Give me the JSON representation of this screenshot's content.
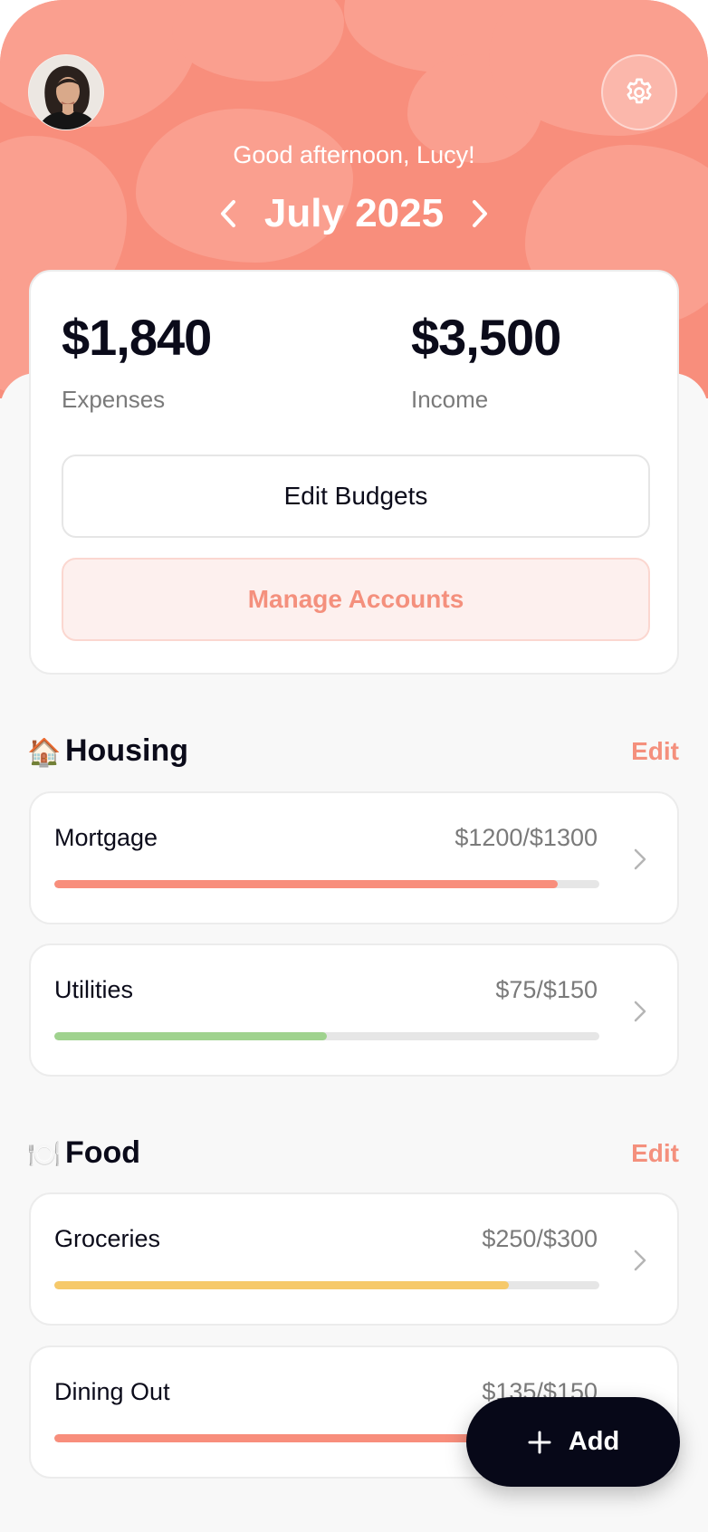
{
  "header": {
    "greeting": "Good afternoon, Lucy!",
    "month": "July 2025",
    "avatar_icon": "user-avatar",
    "settings_icon": "gear-icon",
    "prev_icon": "chevron-left-icon",
    "next_icon": "chevron-right-icon"
  },
  "summary": {
    "expenses_value": "$1,840",
    "expenses_label": "Expenses",
    "income_value": "$3,500",
    "income_label": "Income",
    "edit_budgets_label": "Edit Budgets",
    "manage_accounts_label": "Manage Accounts"
  },
  "sections": [
    {
      "emoji": "🏠",
      "title": "Housing",
      "edit_label": "Edit",
      "items": [
        {
          "name": "Mortgage",
          "amount": "$1200/$1300",
          "spent": 1200,
          "budget": 1300,
          "bar_color": "#f88e7c"
        },
        {
          "name": "Utilities",
          "amount": "$75/$150",
          "spent": 75,
          "budget": 150,
          "bar_color": "#9fd28e"
        }
      ]
    },
    {
      "emoji": "🍽️",
      "title": "Food",
      "edit_label": "Edit",
      "items": [
        {
          "name": "Groceries",
          "amount": "$250/$300",
          "spent": 250,
          "budget": 300,
          "bar_color": "#f6c96a"
        },
        {
          "name": "Dining Out",
          "amount": "$135/$150",
          "spent": 135,
          "budget": 150,
          "bar_color": "#f88e7c"
        }
      ]
    }
  ],
  "fab": {
    "label": "Add",
    "icon": "plus-icon"
  },
  "colors": {
    "accent": "#f88e7c",
    "accent_text": "#f4907d",
    "dark": "#070818"
  }
}
